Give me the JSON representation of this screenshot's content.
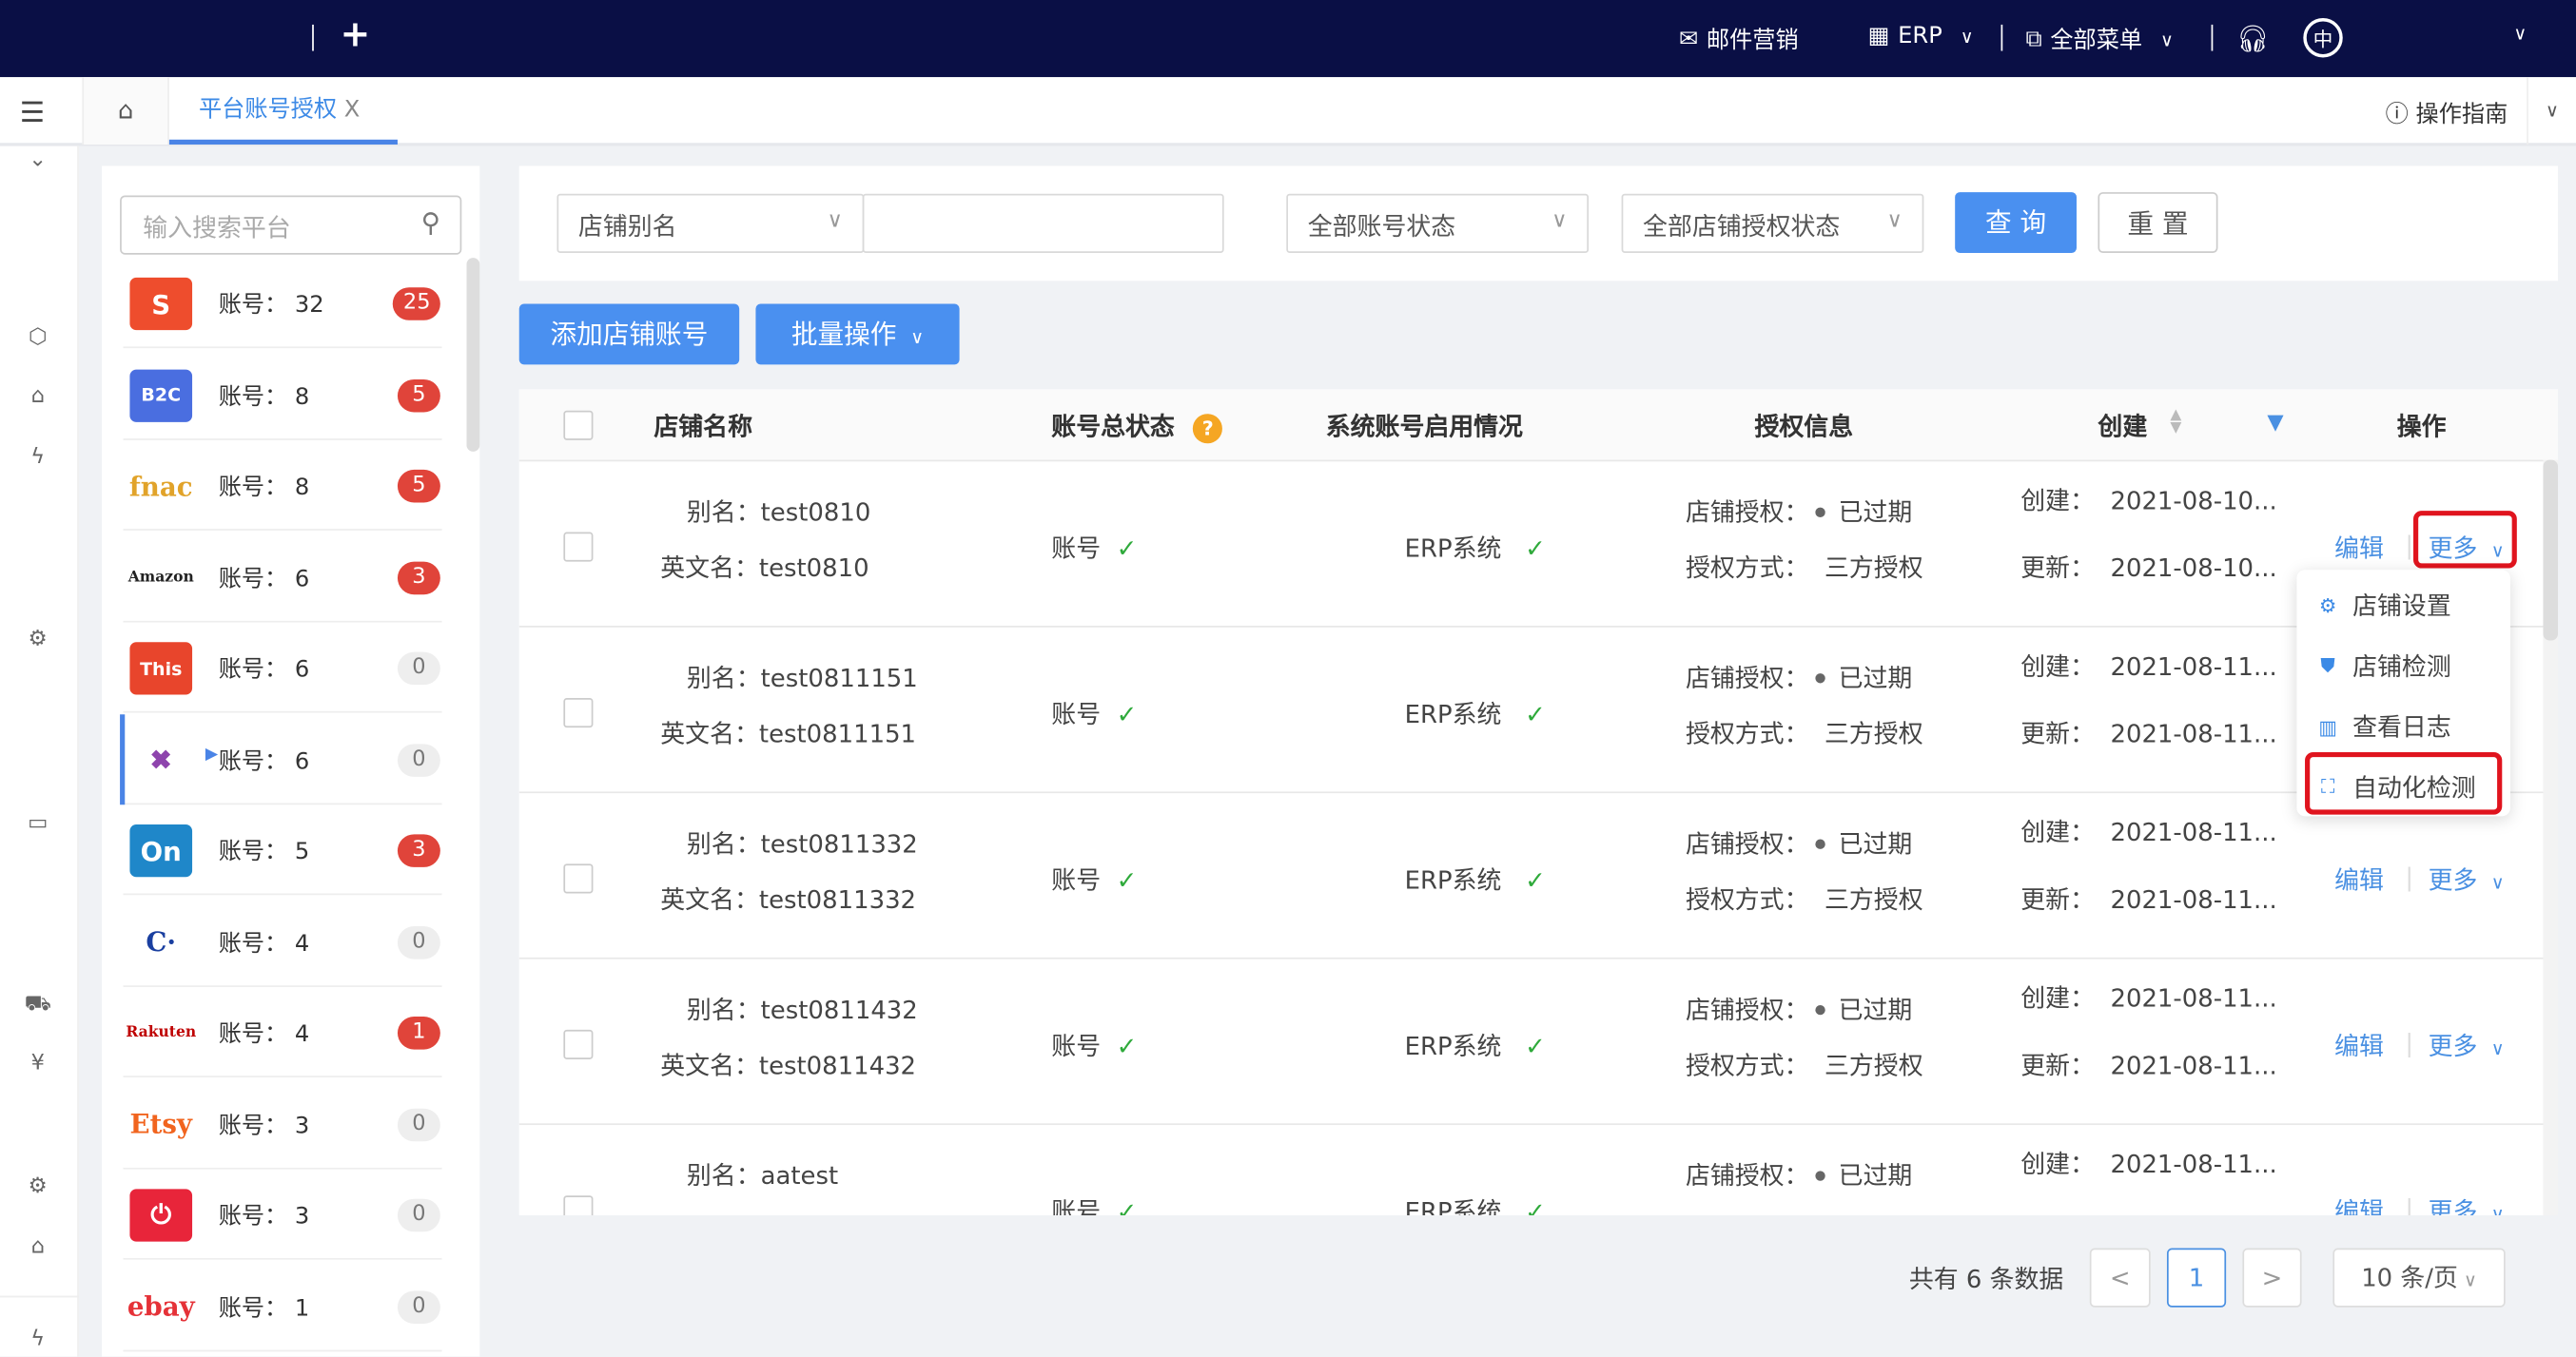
{
  "topbar": {
    "add_icon": "plus-icon",
    "email": "邮件营销",
    "erp": "ERP",
    "all_menu": "全部菜单",
    "lang": "中"
  },
  "tabbar": {
    "tab": "平台账号授权",
    "close": "X",
    "guide": "操作指南"
  },
  "platforms": {
    "search_placeholder": "输入搜索平台",
    "label": "账号：",
    "items": [
      {
        "name": "Shopee",
        "logo": "S",
        "count": "32",
        "badge": "25",
        "color": "#ee4d2d",
        "badge_red": true
      },
      {
        "name": "B2C",
        "logo": "B2C",
        "count": "8",
        "badge": "5",
        "color": "#4a6ee0",
        "badge_red": true
      },
      {
        "name": "fnac",
        "logo": "fnac",
        "count": "8",
        "badge": "5",
        "color": "#e1a32a",
        "badge_red": true
      },
      {
        "name": "Amazon",
        "logo": "Amazon",
        "count": "6",
        "badge": "3",
        "color": "#222",
        "badge_red": true
      },
      {
        "name": "This",
        "logo": "This",
        "count": "6",
        "badge": "0",
        "color": "#e8452c",
        "badge_red": false
      },
      {
        "name": "Wish",
        "logo": "✖",
        "count": "6",
        "badge": "0",
        "color": "#8e44ad",
        "badge_red": false,
        "selected": true
      },
      {
        "name": "On",
        "logo": "On",
        "count": "5",
        "badge": "3",
        "color": "#1f87c9",
        "badge_red": true
      },
      {
        "name": "Cdiscount",
        "logo": "C·",
        "count": "4",
        "badge": "0",
        "color": "#1a3fa0",
        "badge_red": false
      },
      {
        "name": "Rakuten",
        "logo": "Rakuten",
        "count": "4",
        "badge": "1",
        "color": "#bf0000",
        "badge_red": true
      },
      {
        "name": "Etsy",
        "logo": "Etsy",
        "count": "3",
        "badge": "0",
        "color": "#f1641e",
        "badge_red": false
      },
      {
        "name": "Power",
        "logo": "⏻",
        "count": "3",
        "badge": "0",
        "color": "#e8253a",
        "badge_red": false
      },
      {
        "name": "ebay",
        "logo": "ebay",
        "count": "1",
        "badge": "0",
        "color": "#e53238",
        "badge_red": false
      }
    ]
  },
  "filters": {
    "alias_select": "店铺别名",
    "alias_value": "",
    "account_status": "全部账号状态",
    "auth_status": "全部店铺授权状态",
    "query": "查 询",
    "reset": "重 置"
  },
  "actions": {
    "add": "添加店铺账号",
    "batch": "批量操作"
  },
  "table": {
    "headers": {
      "name": "店铺名称",
      "status": "账号总状态",
      "system": "系统账号启用情况",
      "auth": "授权信息",
      "created": "创建",
      "ops": "操作"
    },
    "rows": [
      {
        "alias": "test0810",
        "en": "test0810",
        "status": "账号",
        "system": "ERP系统",
        "auth": "已过期",
        "auth_method": "三方授权",
        "created": "2021-08-10...",
        "updated": "2021-08-10..."
      },
      {
        "alias": "test0811151",
        "en": "test0811151",
        "status": "账号",
        "system": "ERP系统",
        "auth": "已过期",
        "auth_method": "三方授权",
        "created": "2021-08-11...",
        "updated": "2021-08-11..."
      },
      {
        "alias": "test0811332",
        "en": "test0811332",
        "status": "账号",
        "system": "ERP系统",
        "auth": "已过期",
        "auth_method": "三方授权",
        "created": "2021-08-11...",
        "updated": "2021-08-11..."
      },
      {
        "alias": "test0811432",
        "en": "test0811432",
        "status": "账号",
        "system": "ERP系统",
        "auth": "已过期",
        "auth_method": "三方授权",
        "created": "2021-08-11...",
        "updated": "2021-08-11..."
      },
      {
        "alias": "aatest",
        "en": "",
        "status": "账号",
        "system": "ERP系统",
        "auth": "已过期",
        "auth_method": "",
        "created": "2021-08-11...",
        "updated": ""
      }
    ],
    "labels": {
      "alias": "别名：",
      "en": "英文名：",
      "store_auth": "店铺授权：",
      "auth_method": "授权方式：",
      "created": "创建：",
      "updated": "更新：",
      "edit": "编辑",
      "more": "更多"
    }
  },
  "more_menu": [
    {
      "label": "店铺设置",
      "icon": "gear-icon"
    },
    {
      "label": "店铺检测",
      "icon": "shield-search-icon"
    },
    {
      "label": "查看日志",
      "icon": "book-icon"
    },
    {
      "label": "自动化检测",
      "icon": "scan-icon"
    }
  ],
  "pagination": {
    "total": "共有 6 条数据",
    "page": "1",
    "page_size": "10 条/页"
  }
}
